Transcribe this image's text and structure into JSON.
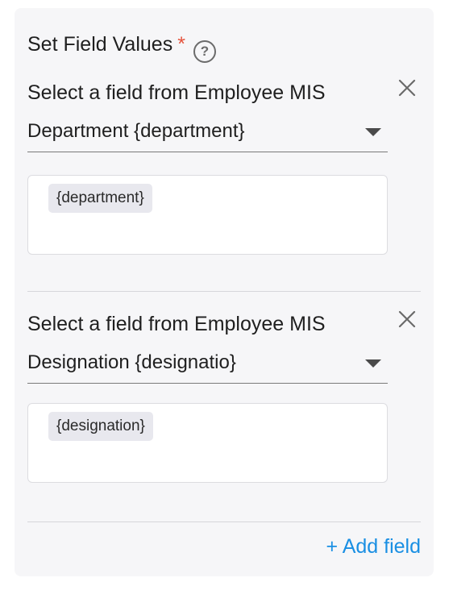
{
  "section": {
    "title": "Set Field Values",
    "required_mark": "*",
    "help_glyph": "?"
  },
  "fields": [
    {
      "label": "Select a field from Employee MIS",
      "selected": "Department {department}",
      "token": "{department}"
    },
    {
      "label": "Select a field from Employee MIS",
      "selected": "Designation {designatio}",
      "token": "{designation}"
    }
  ],
  "actions": {
    "add_field": "+ Add field"
  },
  "icons": {
    "help": "help-circle-icon",
    "close": "close-icon",
    "dropdown": "chevron-down-icon"
  },
  "colors": {
    "accent": "#1a8fe3",
    "required": "#e5533d",
    "panel_bg": "#f6f6f8"
  }
}
